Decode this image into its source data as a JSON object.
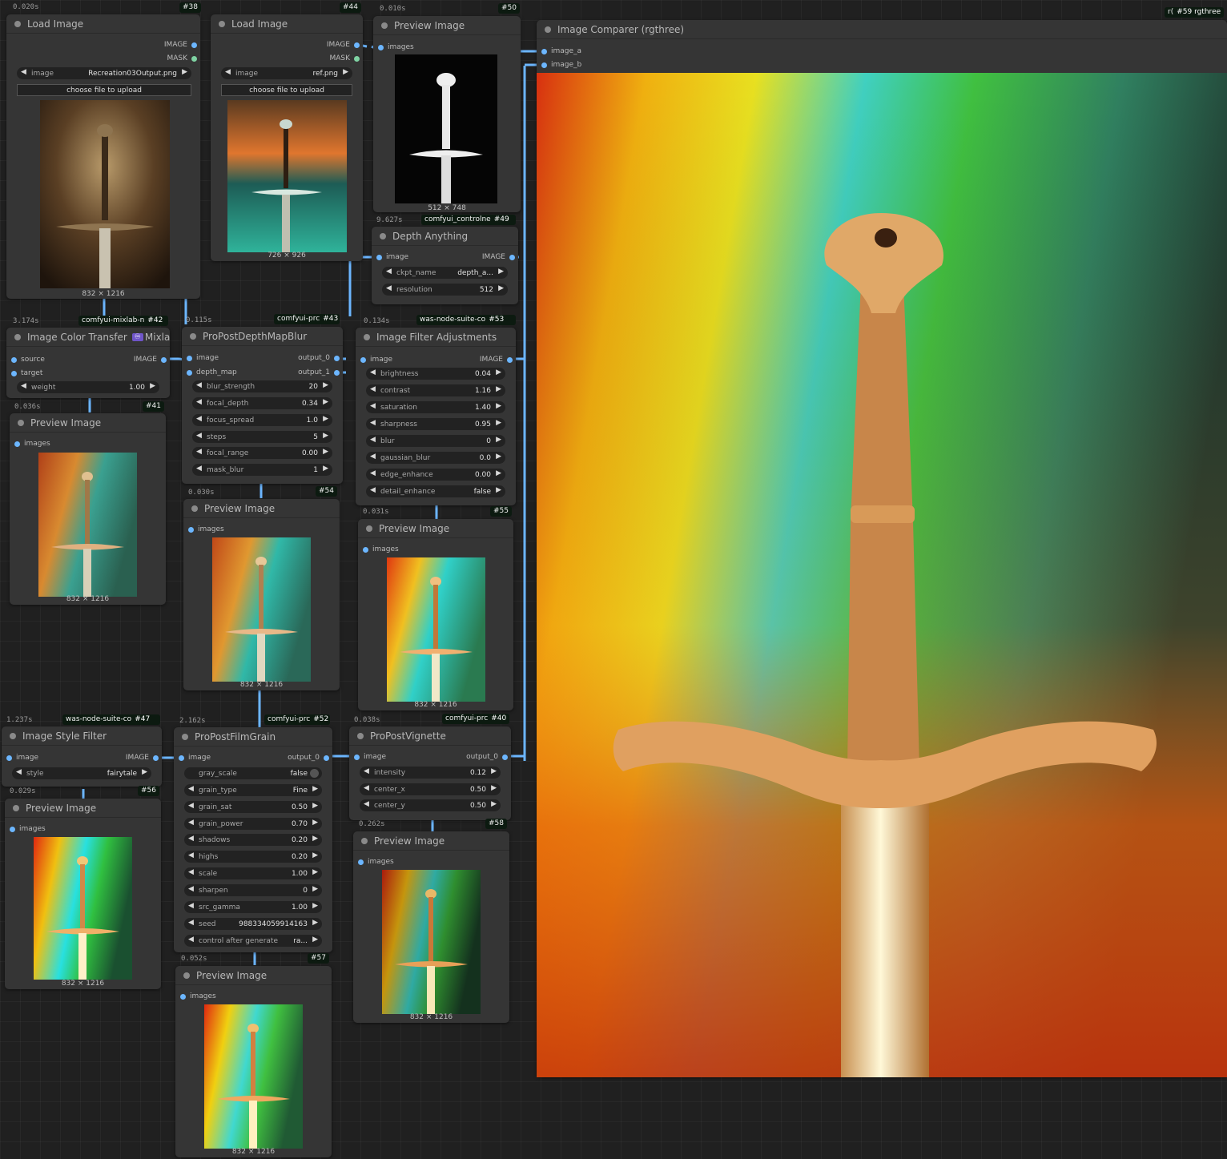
{
  "n38": {
    "time": "0.020s",
    "badge": "#38",
    "title": "Load Image",
    "out1": "IMAGE",
    "out2": "MASK",
    "w_image_label": "image",
    "w_image_value": "Recreation03Output.png",
    "upload": "choose file to upload",
    "caption": "832 × 1216"
  },
  "n44": {
    "badge": "#44",
    "title": "Load Image",
    "out1": "IMAGE",
    "out2": "MASK",
    "w_image_label": "image",
    "w_image_value": "ref.png",
    "upload": "choose file to upload",
    "caption": "726 × 926"
  },
  "n50": {
    "time": "0.010s",
    "badge": "#50",
    "title": "Preview Image",
    "in1": "images",
    "caption": "512 × 748"
  },
  "n49": {
    "time": "9.627s",
    "pack": "comfyui_controlne",
    "badge": "#49",
    "title": "Depth Anything",
    "in1": "image",
    "out1": "IMAGE",
    "w1_label": "ckpt_name",
    "w1_value": "depth_a...",
    "w2_label": "resolution",
    "w2_value": "512"
  },
  "n59": {
    "pack": "r(",
    "badge": "#59 rgthree",
    "title": "Image Comparer (rgthree)",
    "in1": "image_a",
    "in2": "image_b"
  },
  "n42": {
    "time": "3.174s",
    "pack": "comfyui-mixlab-n",
    "badge": "#42",
    "title": "Image Color Transfer",
    "tag": "♾",
    "tag_label": "Mixlab",
    "in1": "source",
    "in2": "target",
    "out1": "IMAGE",
    "w1_label": "weight",
    "w1_value": "1.00"
  },
  "n43": {
    "time": "0.115s",
    "pack": "comfyui-prc",
    "badge": "#43",
    "title": "ProPostDepthMapBlur",
    "in1": "image",
    "in2": "depth_map",
    "out1": "output_0",
    "out2": "output_1",
    "w1_label": "blur_strength",
    "w1_value": "20",
    "w2_label": "focal_depth",
    "w2_value": "0.34",
    "w3_label": "focus_spread",
    "w3_value": "1.0",
    "w4_label": "steps",
    "w4_value": "5",
    "w5_label": "focal_range",
    "w5_value": "0.00",
    "w6_label": "mask_blur",
    "w6_value": "1"
  },
  "n53": {
    "time": "0.134s",
    "pack": "was-node-suite-co",
    "badge": "#53",
    "title": "Image Filter Adjustments",
    "in1": "image",
    "out1": "IMAGE",
    "w1_label": "brightness",
    "w1_value": "0.04",
    "w2_label": "contrast",
    "w2_value": "1.16",
    "w3_label": "saturation",
    "w3_value": "1.40",
    "w4_label": "sharpness",
    "w4_value": "0.95",
    "w5_label": "blur",
    "w5_value": "0",
    "w6_label": "gaussian_blur",
    "w6_value": "0.0",
    "w7_label": "edge_enhance",
    "w7_value": "0.00",
    "w8_label": "detail_enhance",
    "w8_value": "false"
  },
  "n41": {
    "time": "0.036s",
    "badge": "#41",
    "title": "Preview Image",
    "in1": "images",
    "caption": "832 × 1216"
  },
  "n54": {
    "time": "0.030s",
    "badge": "#54",
    "title": "Preview Image",
    "in1": "images",
    "caption": "832 × 1216"
  },
  "n55": {
    "time": "0.031s",
    "badge": "#55",
    "title": "Preview Image",
    "in1": "images",
    "caption": "832 × 1216"
  },
  "n47": {
    "time": "1.237s",
    "pack": "was-node-suite-co",
    "badge": "#47",
    "title": "Image Style Filter",
    "in1": "image",
    "out1": "IMAGE",
    "w1_label": "style",
    "w1_value": "fairytale"
  },
  "n52": {
    "time": "2.162s",
    "pack": "comfyui-prc",
    "badge": "#52",
    "title": "ProPostFilmGrain",
    "in1": "image",
    "out1": "output_0",
    "w1_label": "gray_scale",
    "w1_value": "false",
    "w2_label": "grain_type",
    "w2_value": "Fine",
    "w3_label": "grain_sat",
    "w3_value": "0.50",
    "w4_label": "grain_power",
    "w4_value": "0.70",
    "w5_label": "shadows",
    "w5_value": "0.20",
    "w6_label": "highs",
    "w6_value": "0.20",
    "w7_label": "scale",
    "w7_value": "1.00",
    "w8_label": "sharpen",
    "w8_value": "0",
    "w9_label": "src_gamma",
    "w9_value": "1.00",
    "w10_label": "seed",
    "w10_value": "988334059914163",
    "w11_label": "control after generate",
    "w11_value": "ra..."
  },
  "n40": {
    "time": "0.038s",
    "pack": "comfyui-prc",
    "badge": "#40",
    "title": "ProPostVignette",
    "in1": "image",
    "out1": "output_0",
    "w1_label": "intensity",
    "w1_value": "0.12",
    "w2_label": "center_x",
    "w2_value": "0.50",
    "w3_label": "center_y",
    "w3_value": "0.50"
  },
  "n56": {
    "time": "0.029s",
    "badge": "#56",
    "title": "Preview Image",
    "in1": "images",
    "caption": "832 × 1216"
  },
  "n57": {
    "time": "0.052s",
    "badge": "#57",
    "title": "Preview Image",
    "in1": "images",
    "caption": "832 × 1216"
  },
  "n58": {
    "time": "0.262s",
    "badge": "#58",
    "title": "Preview Image",
    "in1": "images",
    "caption": "832 × 1216"
  },
  "colors": {
    "link": "#6cb6ff",
    "node_bg": "#353535",
    "canvas_bg": "#202020",
    "badge_bg": "#0c1a10"
  }
}
